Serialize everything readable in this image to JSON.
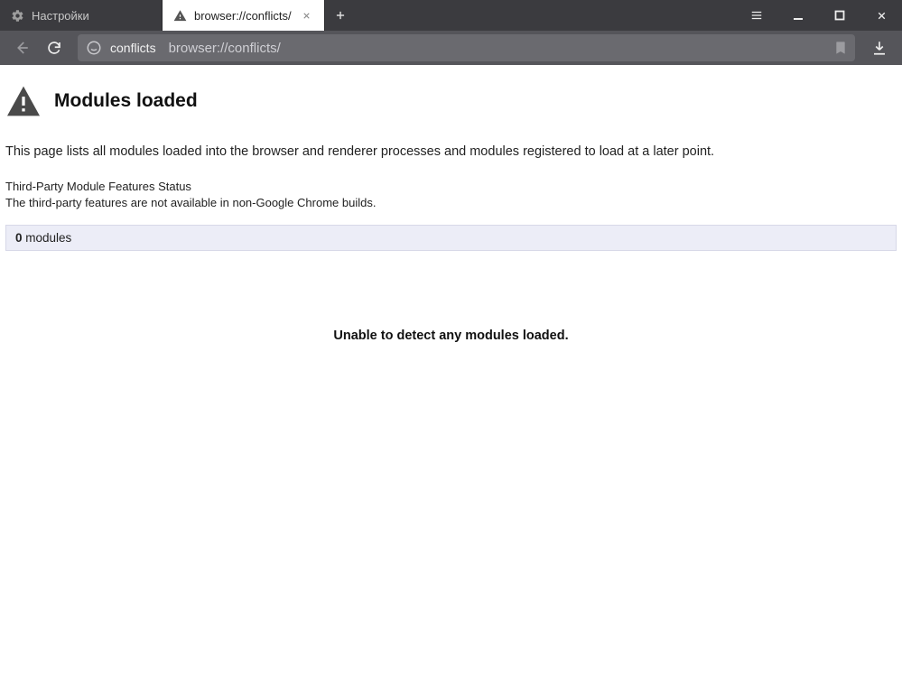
{
  "tabs": {
    "items": [
      {
        "label": "Настройки"
      },
      {
        "label": "browser://conflicts/"
      }
    ]
  },
  "address": {
    "hostname": "conflicts",
    "url": "browser://conflicts/"
  },
  "page": {
    "title": "Modules loaded",
    "description": "This page lists all modules loaded into the browser and renderer processes and modules registered to load at a later point.",
    "third_party_title": "Third-Party Module Features Status",
    "third_party_msg": "The third-party features are not available in non-Google Chrome builds.",
    "module_count": "0",
    "module_label": " modules",
    "empty_msg": "Unable to detect any modules loaded."
  }
}
